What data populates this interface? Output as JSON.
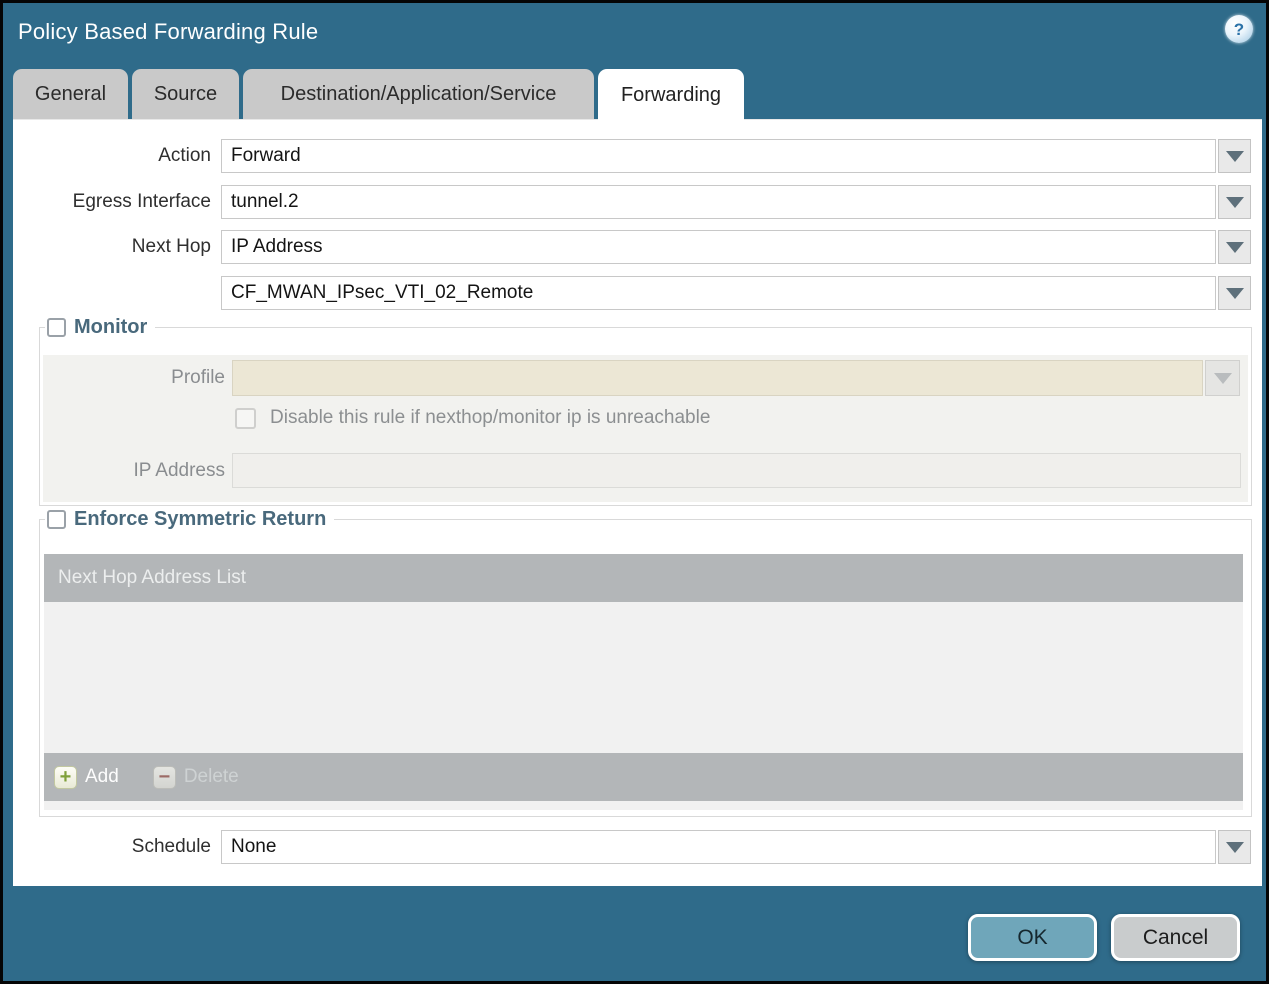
{
  "window": {
    "title": "Policy Based Forwarding Rule",
    "help_glyph": "?"
  },
  "tabs": [
    {
      "label": "General",
      "active": false
    },
    {
      "label": "Source",
      "active": false
    },
    {
      "label": "Destination/Application/Service",
      "active": false
    },
    {
      "label": "Forwarding",
      "active": true
    }
  ],
  "form": {
    "action": {
      "label": "Action",
      "value": "Forward"
    },
    "egress_interface": {
      "label": "Egress Interface",
      "value": "tunnel.2"
    },
    "next_hop": {
      "label": "Next Hop",
      "value": "IP Address"
    },
    "next_hop_value": {
      "value": "CF_MWAN_IPsec_VTI_02_Remote"
    },
    "schedule": {
      "label": "Schedule",
      "value": "None"
    }
  },
  "monitor": {
    "title": "Monitor",
    "checked": false,
    "profile_label": "Profile",
    "profile_value": "",
    "disable_checkbox_label": "Disable this rule if nexthop/monitor ip is unreachable",
    "disable_checkbox_checked": false,
    "ip_address_label": "IP Address",
    "ip_address_value": ""
  },
  "symmetric_return": {
    "title": "Enforce Symmetric Return",
    "checked": false,
    "table_header": "Next Hop Address List",
    "table_rows": [],
    "add_label": "Add",
    "delete_label": "Delete"
  },
  "footer": {
    "ok_label": "OK",
    "cancel_label": "Cancel"
  },
  "colors": {
    "titlebar_teal": "#2f6b8a",
    "tab_gray": "#c9c9c9",
    "section_title": "#49697c",
    "disabled_field_cream": "#ece7d5",
    "panel_gray": "#f2f2ef",
    "table_gray": "#b3b6b8",
    "table_body": "#f1f1f1",
    "ok_button": "#6fa6ba",
    "cancel_button": "#c9cccd",
    "add_plus_green": "#7fa03a",
    "delete_minus_red": "#9c6b66"
  }
}
